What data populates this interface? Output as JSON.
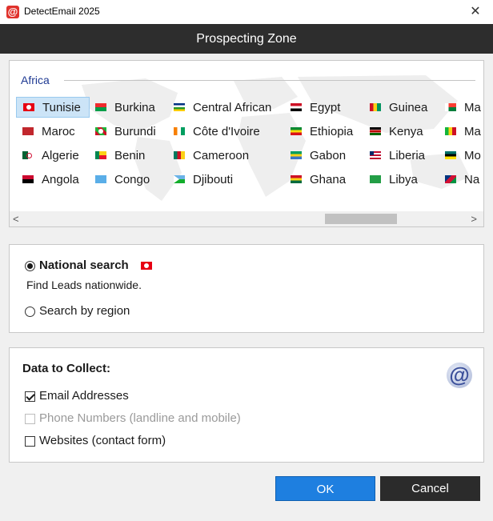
{
  "window": {
    "title": "DetectEmail 2025",
    "icon": "at-icon",
    "close_glyph": "✕"
  },
  "header": {
    "title": "Prospecting Zone"
  },
  "region": {
    "label": "Africa"
  },
  "countries": [
    {
      "label": "Tunisie",
      "selected": true
    },
    {
      "label": "Burkina"
    },
    {
      "label": "Central African"
    },
    {
      "label": "Egypt"
    },
    {
      "label": "Guinea"
    },
    {
      "label": "Ma"
    },
    {
      "label": "Maroc"
    },
    {
      "label": "Burundi"
    },
    {
      "label": "Côte d'Ivoire"
    },
    {
      "label": "Ethiopia"
    },
    {
      "label": "Kenya"
    },
    {
      "label": "Ma"
    },
    {
      "label": "Algerie"
    },
    {
      "label": "Benin"
    },
    {
      "label": "Cameroon"
    },
    {
      "label": "Gabon"
    },
    {
      "label": "Liberia"
    },
    {
      "label": "Mo"
    },
    {
      "label": "Angola"
    },
    {
      "label": "Congo"
    },
    {
      "label": "Djibouti"
    },
    {
      "label": "Ghana"
    },
    {
      "label": "Libya"
    },
    {
      "label": "Na"
    }
  ],
  "scrollbar": {
    "left_arrow": "<",
    "right_arrow": ">"
  },
  "search": {
    "national_label": "National search",
    "national_description": "Find Leads nationwide.",
    "region_label": "Search by region"
  },
  "data_collect": {
    "title": "Data to Collect:",
    "email_label": "Email Addresses",
    "phone_label": "Phone Numbers (landline and mobile)",
    "websites_label": "Websites (contact form)",
    "email_checked": true,
    "phone_checked": false,
    "websites_checked": false
  },
  "buttons": {
    "ok": "OK",
    "cancel": "Cancel"
  },
  "colors": {
    "accent": "#1e7fe0",
    "header_bg": "#2d2d2d",
    "region_text": "#1f3a93"
  }
}
